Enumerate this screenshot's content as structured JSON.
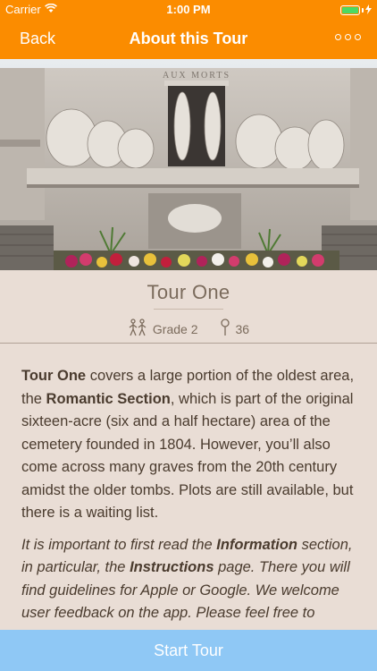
{
  "status_bar": {
    "carrier": "Carrier",
    "time": "1:00 PM"
  },
  "nav": {
    "back_label": "Back",
    "title": "About this Tour",
    "more_icon": "more-circles-icon"
  },
  "hero_image": {
    "inscription": "AUX MORTS"
  },
  "tour": {
    "title": "Tour One",
    "grade": "Grade 2",
    "stop_count": "36"
  },
  "description": {
    "p1_lead": "Tour One",
    "p1_a": " covers a large portion of the oldest area, the ",
    "p1_bold": "Romantic Section",
    "p1_b": ", which is part of the original sixteen-acre (six and a half hectare) area of the cemetery founded in 1804. However, you’ll also come across many graves from the 20th century amidst the older tombs. Plots are still available, but there is a waiting list.",
    "p2_a": "It is important to first read the ",
    "p2_bold1": "Information",
    "p2_b": " section, in particular, the ",
    "p2_bold2": "Instructions",
    "p2_c": " page. There you will find guidelines for Apple or Google. We welcome user feedback on the app. Please feel free to contact us to",
    "p2_hidden": ""
  },
  "footer": {
    "start_label": "Start Tour"
  },
  "colors": {
    "nav_bg": "#fb8c00",
    "page_bg": "#e9ddd5",
    "start_bg": "#8fc8f5"
  }
}
